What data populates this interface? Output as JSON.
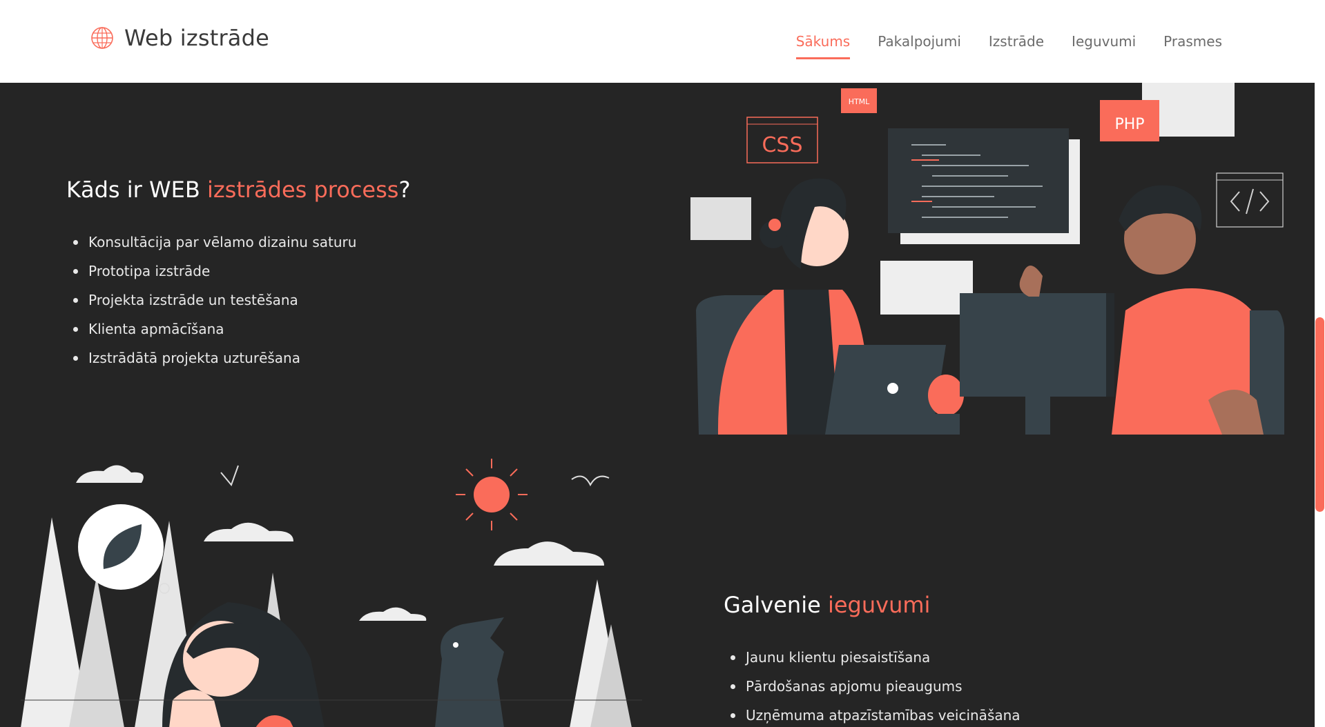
{
  "header": {
    "brand": "Web izstrāde",
    "nav": [
      {
        "label": "Sākums",
        "active": true
      },
      {
        "label": "Pakalpojumi",
        "active": false
      },
      {
        "label": "Izstrāde",
        "active": false
      },
      {
        "label": "Ieguvumi",
        "active": false
      },
      {
        "label": "Prasmes",
        "active": false
      }
    ]
  },
  "process": {
    "heading_prefix": "Kāds ir WEB ",
    "heading_accent": "izstrādes process",
    "heading_suffix": "?",
    "items": [
      "Konsultācija par vēlamo dizainu saturu",
      "Prototipa izstrāde",
      "Projekta izstrāde un testēšana",
      "Klienta apmācīšana",
      "Izstrādātā projekta uzturēšana"
    ]
  },
  "benefits": {
    "heading_prefix": "Galvenie ",
    "heading_accent": "ieguvumi",
    "items": [
      "Jaunu klientu piesaistīšana",
      "Pārdošanas apjomu pieaugums",
      "Uzņēmuma atpazīstamības veicināšana"
    ]
  },
  "illustration_labels": {
    "css": "CSS",
    "html": "HTML",
    "php": "PHP"
  },
  "colors": {
    "accent": "#fa6c5a",
    "background": "#252525",
    "header_bg": "#ffffff"
  },
  "icons": {
    "logo": "globe-icon"
  }
}
